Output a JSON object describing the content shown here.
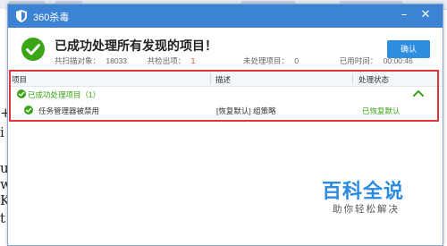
{
  "window": {
    "title": "360杀毒"
  },
  "summary": {
    "headline": "已成功处理所有发现的项目！",
    "scanned_label": "共扫描对象：",
    "scanned_value": "18033",
    "detected_label": "共检出项：",
    "detected_value": "1",
    "unprocessed_label": "未处理项目：",
    "unprocessed_value": "0",
    "time_label": "已用时间：",
    "time_value": "00:00:46",
    "confirm_label": "确认"
  },
  "table": {
    "columns": [
      "项目",
      "描述",
      "处理状态"
    ],
    "group": {
      "label": "已成功处理项目（1）"
    },
    "rows": [
      {
        "name": "任务管理器被禁用",
        "description": "[恢复默认] 组策略",
        "status": "已恢复默认"
      }
    ]
  },
  "background": {
    "letters": [
      "+",
      "i",
      "u",
      "w",
      "K",
      "t"
    ]
  },
  "watermark": {
    "title": "百科全说",
    "subtitle": "助你轻松解决"
  },
  "colors": {
    "titlebar": "#3d83d4",
    "success": "#3aa517",
    "highlight": "#e0363a",
    "button": "#2d8ee0"
  },
  "icons": {
    "title": "shield-icon",
    "success": "check-circle-icon",
    "collapse": "chevron-up-icon"
  }
}
